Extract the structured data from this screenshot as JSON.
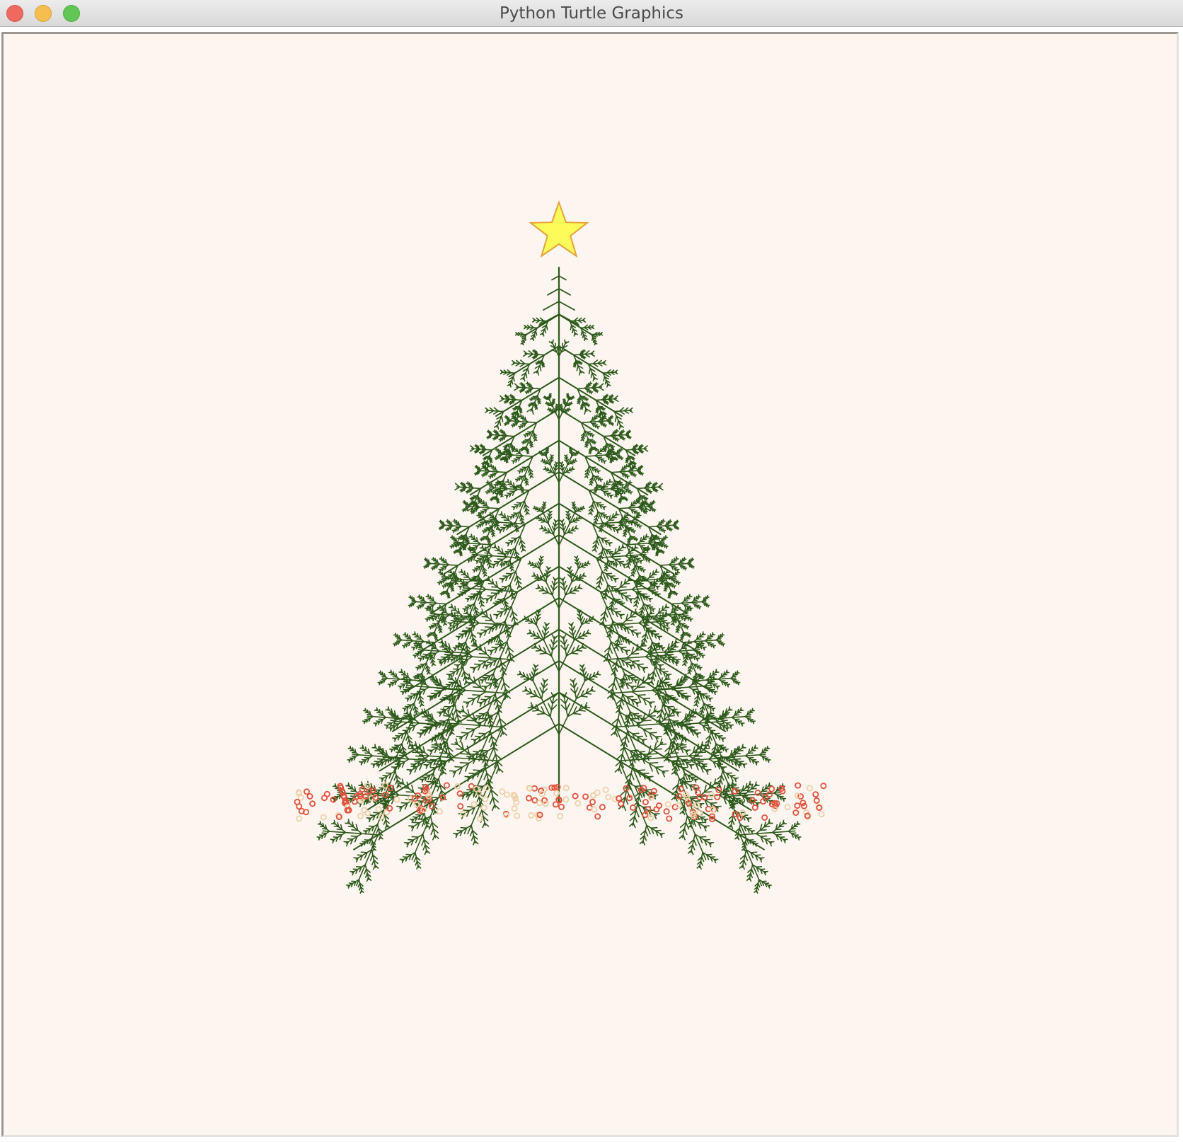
{
  "window": {
    "title": "Python Turtle Graphics",
    "buttons": [
      "close",
      "minimize",
      "maximize"
    ]
  },
  "canvas": {
    "background": "#fdf5f0",
    "tree_color": "#2d5a1b",
    "star_fill": "#fdfb5a",
    "star_stroke": "#e8a23a",
    "ornament_colors": [
      "#e2503c",
      "#f0d0a8"
    ]
  }
}
